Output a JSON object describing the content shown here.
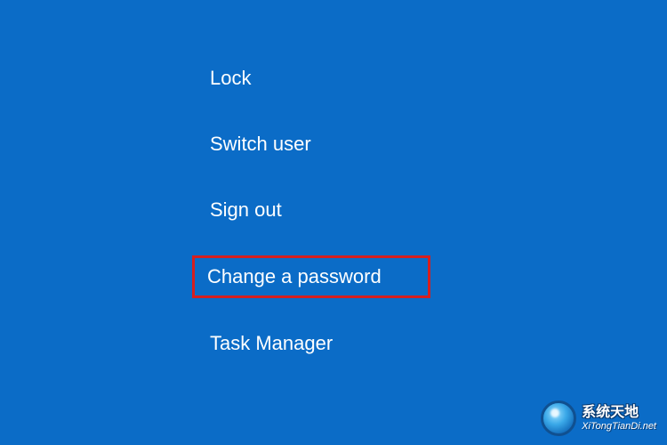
{
  "menu": {
    "items": [
      {
        "label": "Lock",
        "highlighted": false
      },
      {
        "label": "Switch user",
        "highlighted": false
      },
      {
        "label": "Sign out",
        "highlighted": false
      },
      {
        "label": "Change a password",
        "highlighted": true
      },
      {
        "label": "Task Manager",
        "highlighted": false
      }
    ]
  },
  "watermark": {
    "cn": "系统天地",
    "url": "XiTongTianDi.net"
  },
  "colors": {
    "background": "#0b6cc7",
    "highlight_border": "#d61f1f",
    "text": "#ffffff"
  }
}
